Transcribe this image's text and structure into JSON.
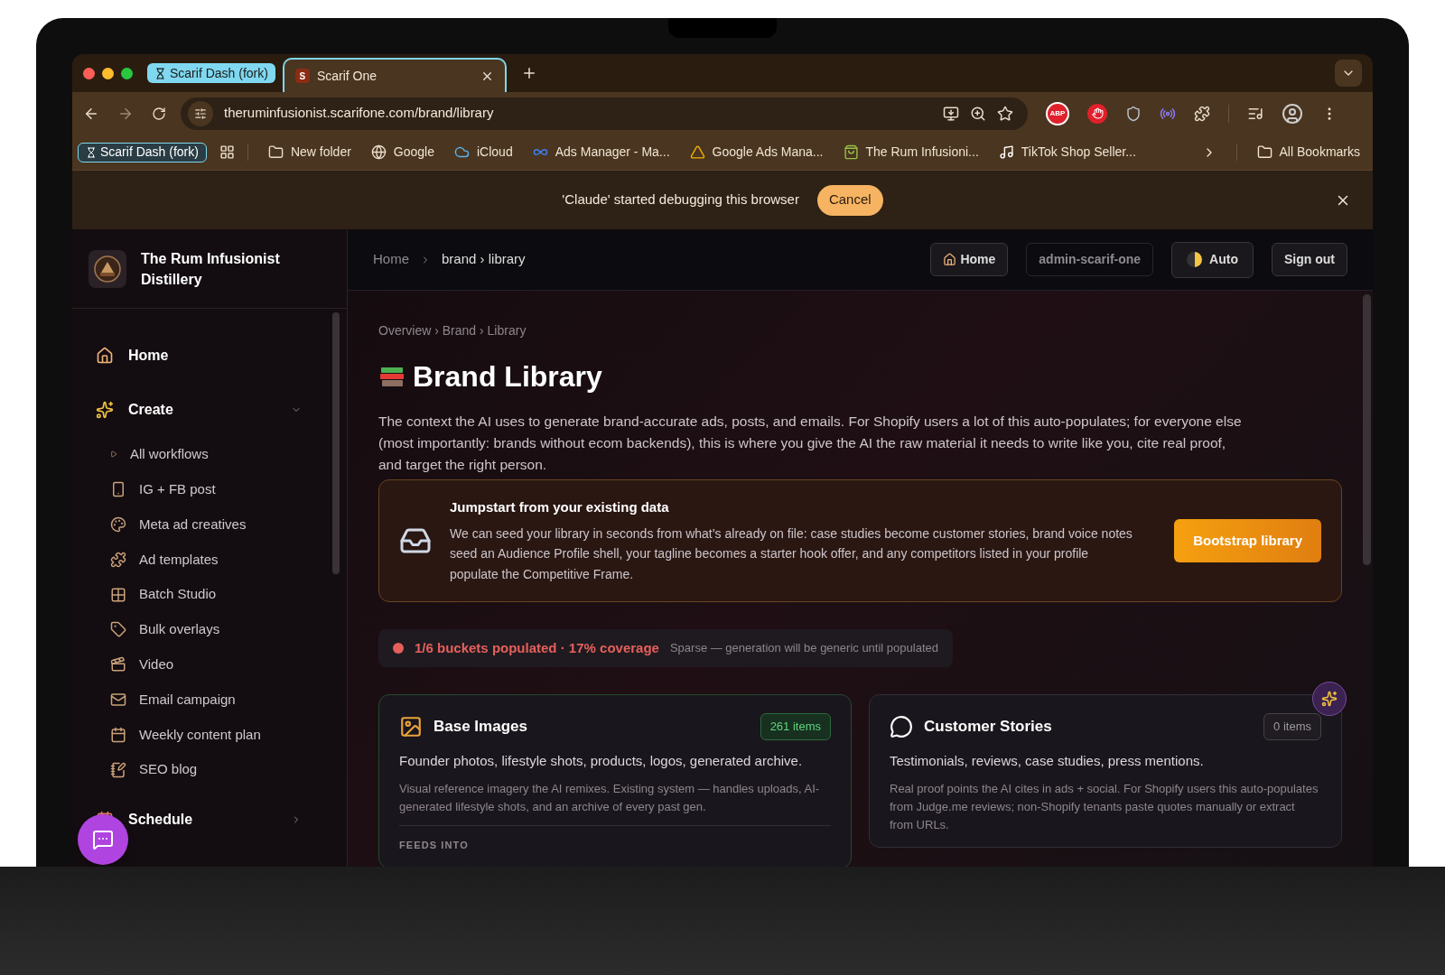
{
  "browser": {
    "tabs": [
      {
        "title": "Scarif Dash (fork)",
        "kind": "group",
        "selected": false
      },
      {
        "title": "Scarif One",
        "kind": "tab",
        "selected": true,
        "favicon": "S"
      }
    ],
    "url": "theruminfusionist.scarifone.com/brand/library",
    "extension_badge": "ABP",
    "bookmarks": [
      {
        "label": "Scarif Dash (fork)",
        "kind": "group"
      },
      {
        "label": "New folder",
        "kind": "link"
      },
      {
        "label": "Google",
        "kind": "link"
      },
      {
        "label": "iCloud",
        "kind": "link"
      },
      {
        "label": "Ads Manager - Ma...",
        "kind": "link"
      },
      {
        "label": "Google Ads Mana...",
        "kind": "link"
      },
      {
        "label": "The Rum Infusioni...",
        "kind": "link"
      },
      {
        "label": "TikTok Shop Seller...",
        "kind": "link"
      }
    ],
    "all_bookmarks": "All Bookmarks"
  },
  "debug_bar": {
    "message": "'Claude' started debugging this browser",
    "button": "Cancel"
  },
  "sidebar": {
    "brand": "The Rum Infusionist Distillery",
    "items": [
      {
        "label": "Home"
      },
      {
        "label": "Create",
        "expanded": true,
        "children": [
          {
            "label": "All workflows"
          },
          {
            "label": "IG + FB post"
          },
          {
            "label": "Meta ad creatives"
          },
          {
            "label": "Ad templates"
          },
          {
            "label": "Batch Studio"
          },
          {
            "label": "Bulk overlays"
          },
          {
            "label": "Video"
          },
          {
            "label": "Email campaign"
          },
          {
            "label": "Weekly content plan"
          },
          {
            "label": "SEO blog"
          }
        ]
      },
      {
        "label": "Schedule",
        "expanded": false
      }
    ]
  },
  "header": {
    "breadcrumb": [
      "Home",
      "brand › library"
    ],
    "buttons": [
      {
        "label": "Home",
        "kind": "home"
      },
      {
        "label": "admin-scarif-one",
        "kind": "account"
      },
      {
        "label": "Auto",
        "kind": "theme"
      },
      {
        "label": "Sign out",
        "kind": "plain"
      }
    ]
  },
  "page": {
    "crumbs": "Overview › Brand › Library",
    "title": "Brand Library",
    "intro": "The context the AI uses to generate brand-accurate ads, posts, and emails. For Shopify users a lot of this auto-populates; for everyone else (most importantly: brands without ecom backends), this is where you give the AI the raw material it needs to write like you, cite real proof, and target the right person.",
    "jumpstart": {
      "title": "Jumpstart from your existing data",
      "text": "We can seed your library in seconds from what’s already on file: case studies become customer stories, brand voice notes seed an Audience Profile shell, your tagline becomes a starter hook offer, and any competitors listed in your profile populate the Competitive Frame.",
      "button": "Bootstrap library"
    },
    "coverage": {
      "status": "1/6 buckets populated · 17% coverage",
      "note": "Sparse — generation will be generic until populated"
    },
    "buckets": [
      {
        "title": "Base Images",
        "count": "261 items",
        "populated": true,
        "summary": "Founder photos, lifestyle shots, products, logos, generated archive.",
        "details": "Visual reference imagery the AI remixes. Existing system — handles uploads, AI-generated lifestyle shots, and an archive of every past gen.",
        "feeds_label": "FEEDS INTO"
      },
      {
        "title": "Customer Stories",
        "count": "0 items",
        "populated": false,
        "summary": "Testimonials, reviews, case studies, press mentions.",
        "details": "Real proof points the AI cites in ads + social. For Shopify users this auto-populates from Judge.me reviews; non-Shopify tenants paste quotes manually or extract from URLs."
      }
    ]
  }
}
